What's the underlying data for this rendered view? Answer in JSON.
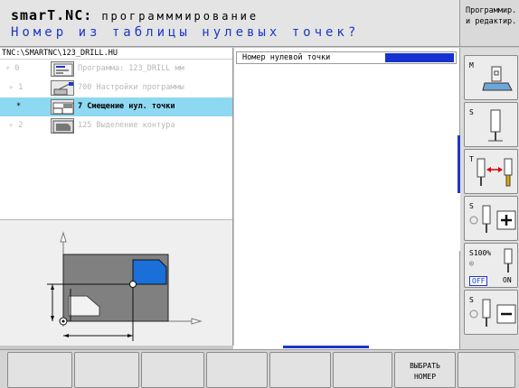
{
  "header": {
    "title": "smarT.NC:",
    "subtitle": "программмирование",
    "prompt": "Номер из таблицы нулевых точек?"
  },
  "mode_box": {
    "line1": "Программир.",
    "line2": "и редактир."
  },
  "tree": {
    "path": "TNC:\\SMARTNC\\123_DRILL.HU",
    "rows": [
      {
        "level": "▿ 0",
        "text": "Программа: 123_DRILL мм",
        "selected": false
      },
      {
        "level": "▹ 1",
        "text": "700 Настройки программы",
        "selected": false
      },
      {
        "level": "*",
        "text": "7 Смещение нул. точки",
        "selected": true
      },
      {
        "level": "▹ 2",
        "text": "125 Выделение контура",
        "selected": false
      }
    ]
  },
  "form": {
    "field_label": "Номер нулевой точки",
    "field_value": ""
  },
  "progress_fraction": 0.38,
  "vkeys": {
    "k1_label": "M",
    "k2_label": "S",
    "k3_label": "T",
    "k4_label": "S",
    "k5_label": "S100%",
    "k5_off": "OFF",
    "k5_on": "ON",
    "k6_label": "S"
  },
  "softkeys": {
    "select_line1": "ВЫБРАТЬ",
    "select_line2": "НОМЕР"
  },
  "colors": {
    "accent": "#1a38c8",
    "selected_row": "#8fd8f2",
    "workpiece": "#808080",
    "pocket": "#1a6fd8"
  }
}
